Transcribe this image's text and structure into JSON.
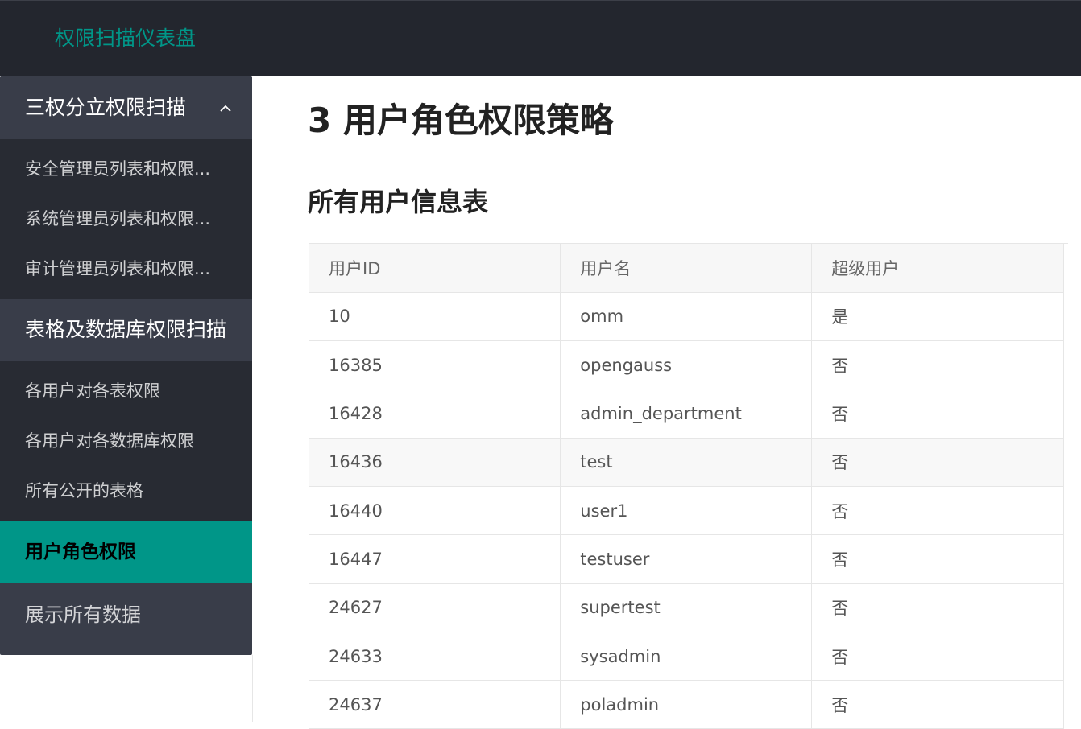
{
  "header": {
    "brand": "权限扫描仪表盘"
  },
  "sidebar": {
    "group1": {
      "label": "三权分立权限扫描",
      "items": [
        "安全管理员列表和权限...",
        "系统管理员列表和权限...",
        "审计管理员列表和权限..."
      ]
    },
    "group2": {
      "label": "表格及数据库权限扫描",
      "items": [
        "各用户对各表权限",
        "各用户对各数据库权限",
        "所有公开的表格"
      ]
    },
    "active_item": "用户角色权限",
    "last_item": "展示所有数据"
  },
  "main": {
    "title": "3 用户角色权限策略",
    "section_title": "所有用户信息表",
    "table": {
      "columns": [
        "用户ID",
        "用户名",
        "超级用户"
      ],
      "rows": [
        [
          "10",
          "omm",
          "是"
        ],
        [
          "16385",
          "opengauss",
          "否"
        ],
        [
          "16428",
          "admin_department",
          "否"
        ],
        [
          "16436",
          "test",
          "否"
        ],
        [
          "16440",
          "user1",
          "否"
        ],
        [
          "16447",
          "testuser",
          "否"
        ],
        [
          "24627",
          "supertest",
          "否"
        ],
        [
          "24633",
          "sysadmin",
          "否"
        ],
        [
          "24637",
          "poladmin",
          "否"
        ]
      ]
    }
  },
  "colors": {
    "accent": "#009688",
    "topbar": "#23262e",
    "sidebar": "#393d49",
    "submenu": "#282b33"
  }
}
